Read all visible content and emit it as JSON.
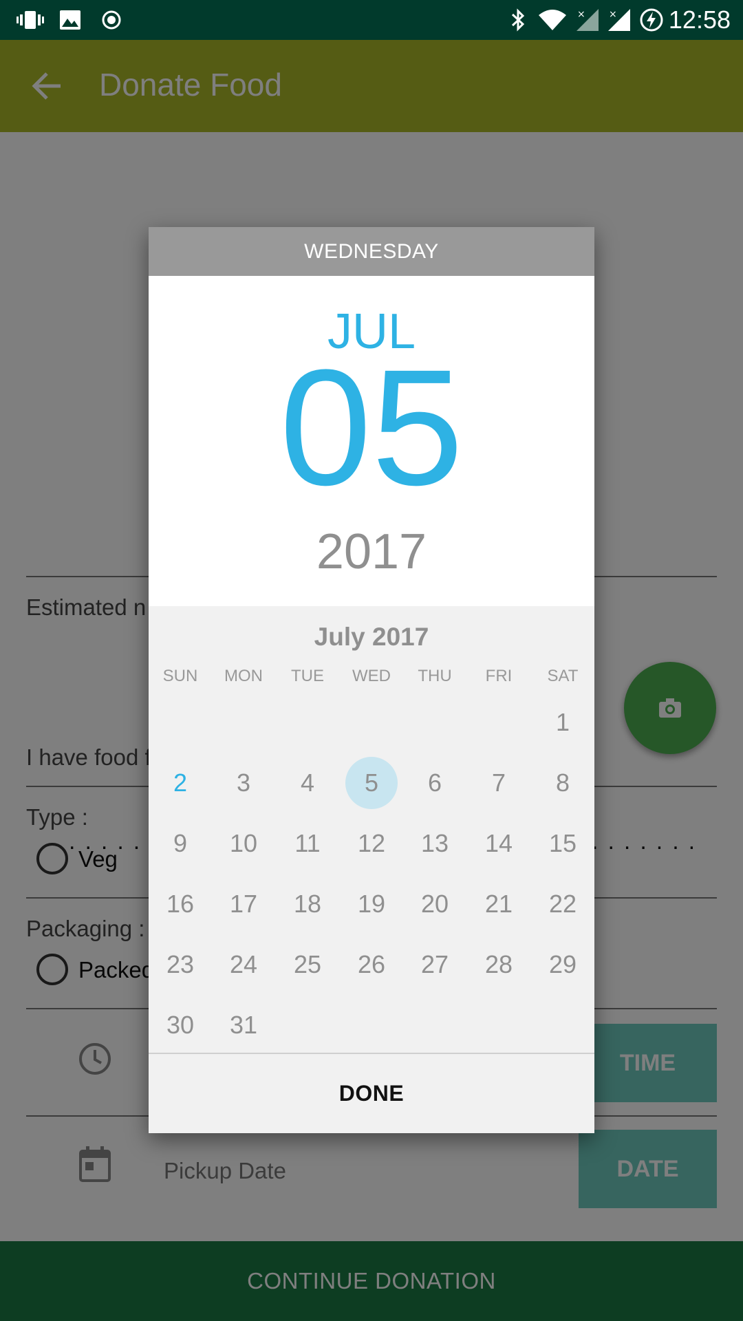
{
  "status_bar": {
    "time": "12:58",
    "left_icons": [
      "vibrate-icon",
      "image-icon",
      "record-icon"
    ],
    "right_icons": [
      "bluetooth-icon",
      "wifi-icon",
      "signal-icon",
      "signal-icon",
      "battery-charging-icon"
    ]
  },
  "app_bar": {
    "title": "Donate Food",
    "back_icon": "arrow-back-icon",
    "color": "#aab829"
  },
  "form": {
    "estimated_label": "Estimated n",
    "have_food_label": "I have food f",
    "type_label": "Type :",
    "type_option": "Veg",
    "packaging_label": "Packaging :",
    "packaging_option": "Packed",
    "time_button": "TIME",
    "pickup_date_label": "Pickup Date",
    "date_button": "DATE",
    "continue_button": "CONTINUE DONATION",
    "camera_icon": "camera-icon",
    "clock_icon": "clock-icon",
    "calendar_icon": "calendar-icon"
  },
  "date_picker": {
    "weekday": "WEDNESDAY",
    "month": "JUL",
    "day": "05",
    "year": "2017",
    "calendar_title": "July 2017",
    "day_headers": [
      "SUN",
      "MON",
      "TUE",
      "WED",
      "THU",
      "FRI",
      "SAT"
    ],
    "first_weekday_index": 6,
    "days_in_month": 31,
    "today": 2,
    "selected": 5,
    "done_label": "DONE",
    "accent_color": "#2eb2e4"
  }
}
